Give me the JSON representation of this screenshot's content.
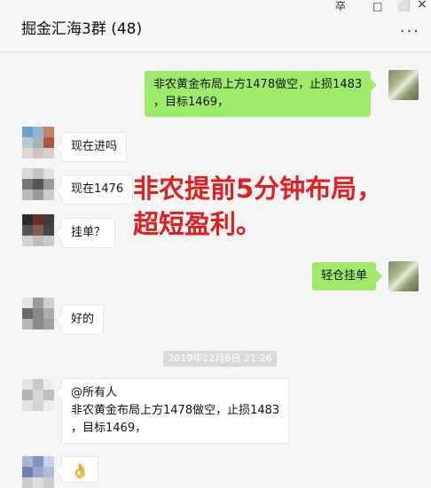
{
  "window": {
    "title": "掘金汇海3群 (48)",
    "more_label": "...",
    "controls": [
      "卒",
      "□",
      "×"
    ]
  },
  "messages": [
    {
      "direction": "out",
      "text": "非农黄金布局上方1478做空，止损1483\n，目标1469，"
    },
    {
      "direction": "in",
      "text": "现在进吗"
    },
    {
      "direction": "in",
      "text": "现在1476"
    },
    {
      "direction": "in",
      "text": "挂单？"
    },
    {
      "direction": "out",
      "text": "轻仓挂单"
    },
    {
      "direction": "in",
      "text": "好的"
    },
    {
      "direction": "in",
      "text": "@所有人\n非农黄金布局上方1478做空，止损1483\n，目标1469，"
    },
    {
      "direction": "in",
      "text": "👌"
    }
  ],
  "timestamp": "2019年12月6日 21:26",
  "overlay": {
    "line1": "非农提前5分钟布局，",
    "line2": "超短盈利。"
  }
}
